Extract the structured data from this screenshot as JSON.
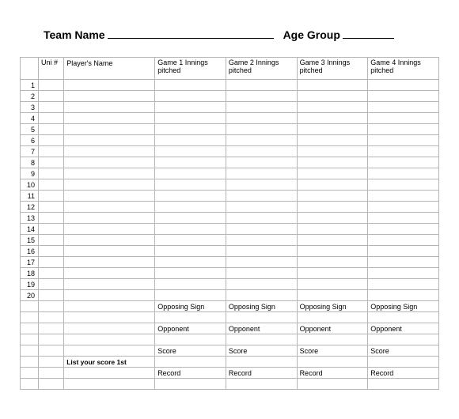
{
  "header": {
    "team_name_label": "Team Name",
    "age_group_label": "Age Group"
  },
  "columns": {
    "uni_header": "Uni #",
    "name_header": "Player's Name",
    "game1_header": "Game 1 Innings pitched",
    "game2_header": "Game 2 Innings pitched",
    "game3_header": "Game 3 Innings pitched",
    "game4_header": "Game 4 Innings pitched"
  },
  "rows": [
    "1",
    "2",
    "3",
    "4",
    "5",
    "6",
    "7",
    "8",
    "9",
    "10",
    "11",
    "12",
    "13",
    "14",
    "15",
    "16",
    "17",
    "18",
    "19",
    "20"
  ],
  "summary": {
    "opposing_sign": "Opposing Sign",
    "opponent": "Opponent",
    "score": "Score",
    "record": "Record",
    "note": "List your score 1st"
  }
}
